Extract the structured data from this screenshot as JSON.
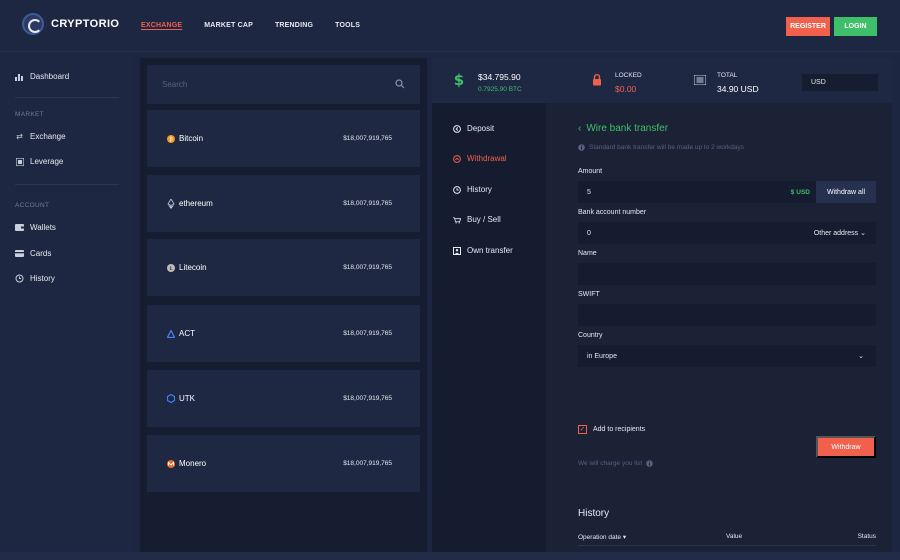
{
  "brand": {
    "name": "CRYPTORIO"
  },
  "topnav": [
    {
      "label": "EXCHANGE",
      "active": true
    },
    {
      "label": "MARKET CAP",
      "active": false
    },
    {
      "label": "TRENDING",
      "active": false
    },
    {
      "label": "TOOLS",
      "active": false
    }
  ],
  "auth": {
    "register_label": "REGISTER",
    "login_label": "LOGIN"
  },
  "sidebar": {
    "dashboard": "Dashboard",
    "market_section": "MARKET",
    "exchange": "Exchange",
    "leverage": "Leverage",
    "account_section": "ACCOUNT",
    "wallets": "Wallets",
    "cards": "Cards",
    "history": "History"
  },
  "search": {
    "placeholder": "Search"
  },
  "coins": [
    {
      "name": "Bitcoin",
      "value": "$18,007,919,765",
      "icon": "bitcoin-icon",
      "color": "#f7931a"
    },
    {
      "name": "ethereum",
      "value": "$18,007,919,765",
      "icon": "ethereum-icon",
      "color": "#c9cfdc"
    },
    {
      "name": "Litecoin",
      "value": "$18,007,919,765",
      "icon": "litecoin-icon",
      "color": "#bfbbbb"
    },
    {
      "name": "ACT",
      "value": "$18,007,919,765",
      "icon": "act-icon",
      "color": "#4b7bec"
    },
    {
      "name": "UTK",
      "value": "$18,007,919,765",
      "icon": "utk-icon",
      "color": "#3b82f6"
    },
    {
      "name": "Monero",
      "value": "$18,007,919,765",
      "icon": "monero-icon",
      "color": "#f26822"
    }
  ],
  "stats": {
    "balance": "$34.795.90",
    "balance_btc": "0.7925.90 BTC",
    "locked_label": "LOCKED",
    "locked_value": "$0.00",
    "total_label": "TOTAL",
    "total_value": "34.90 USD",
    "currency": "USD"
  },
  "subnav": [
    {
      "label": "Deposit",
      "icon": "deposit-icon",
      "active": false
    },
    {
      "label": "Withdrawal",
      "icon": "withdrawal-icon",
      "active": true
    },
    {
      "label": "History",
      "icon": "history-icon",
      "active": false
    },
    {
      "label": "Buy / Sell",
      "icon": "buy-sell-icon",
      "active": false
    },
    {
      "label": "Own transfer",
      "icon": "own-transfer-icon",
      "active": false
    }
  ],
  "form": {
    "title": "Wire bank transfer",
    "note": "Standard bank transfer will be made up to 2 workdays",
    "amount_label": "Amount",
    "amount_value": "5",
    "amount_currency": "USD",
    "withdraw_all_label": "Withdraw all",
    "account_label": "Bank account number",
    "account_value": "0",
    "other_address_label": "Other address",
    "name_label": "Name",
    "name_value": "",
    "swift_label": "SWIFT",
    "swift_value": "",
    "country_label": "Country",
    "country_value": "in Europe",
    "add_recipients_label": "Add to recipients",
    "add_recipients_checked": true,
    "withdraw_label": "Withdraw",
    "charge_note": "We will charge you list"
  },
  "history": {
    "title": "History",
    "columns": [
      "Operation date",
      "Value",
      "Status"
    ]
  },
  "colors": {
    "accent_red": "#f0604d",
    "accent_green": "#3fbf6a",
    "bg_dark": "#161c2f",
    "bg_panel": "#1f2842"
  }
}
